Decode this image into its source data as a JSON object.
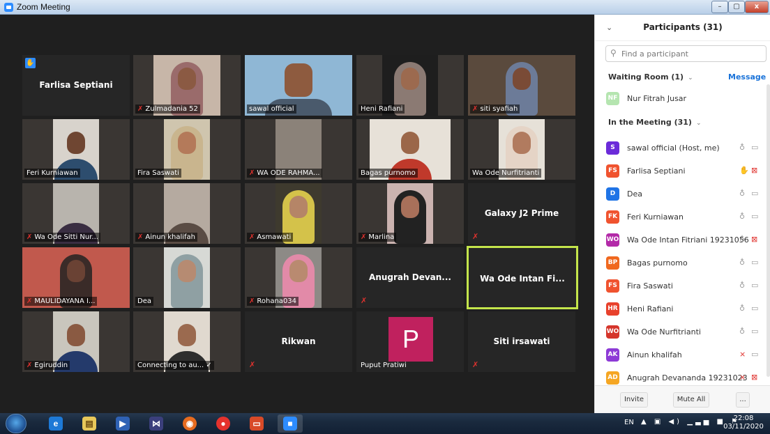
{
  "window": {
    "title": "Zoom Meeting",
    "min": "–",
    "max": "▢",
    "close": "x"
  },
  "tiles": [
    {
      "label": "Farlisa Septiani",
      "hand": true
    },
    {
      "label": "Zulmadania 52",
      "muted": true
    },
    {
      "label": "sawal official"
    },
    {
      "label": "Heni Rafiani"
    },
    {
      "label": "siti syafiah",
      "muted": true
    },
    {
      "label": "Feri Kurniawan"
    },
    {
      "label": "Fira Saswati"
    },
    {
      "label": "WA ODE RAHMA...",
      "muted": true
    },
    {
      "label": "Bagas purnomo"
    },
    {
      "label": "Wa Ode Nurfitrianti"
    },
    {
      "label": "Wa Ode Sitti Nur...",
      "muted": true
    },
    {
      "label": "Ainun khalifah",
      "muted": true
    },
    {
      "label": "Asmawati",
      "muted": true
    },
    {
      "label": "Marlina",
      "muted": true
    },
    {
      "label": "Galaxy J2 Prime"
    },
    {
      "label": "MAULIDAYANA I...",
      "muted": true
    },
    {
      "label": "Dea"
    },
    {
      "label": "Rohana034",
      "muted": true
    },
    {
      "label": "Anugrah  Devan..."
    },
    {
      "label": "Wa  Ode  Intan  Fi..."
    },
    {
      "label": "Egiruddin",
      "muted": true
    },
    {
      "label": "Connecting to au... ✓"
    },
    {
      "label": "Rikwan"
    },
    {
      "label": "Puput Pratiwi",
      "avatar": "P"
    },
    {
      "label": "Siti irsawati"
    }
  ],
  "panel": {
    "title": "Participants (31)",
    "search_placeholder": "Find a participant",
    "waiting_room": "Waiting Room (1)",
    "message": "Message",
    "in_meeting": "In the Meeting (31)",
    "waiting": [
      {
        "initials": "NF",
        "name": "Nur Fitrah Jusar",
        "color": "#b5e5b0"
      }
    ],
    "participants": [
      {
        "initials": "S",
        "name": "sawal official (Host, me)",
        "color": "#6b2bd9",
        "mic": "on",
        "cam": "on"
      },
      {
        "initials": "FS",
        "name": "Farlisa Septiani",
        "color": "#f0532f",
        "mic": "hand",
        "cam": "off"
      },
      {
        "initials": "D",
        "name": "Dea",
        "color": "#1f74e6",
        "mic": "on",
        "cam": "on"
      },
      {
        "initials": "FK",
        "name": "Feri Kurniawan",
        "color": "#f0532f",
        "mic": "on",
        "cam": "on"
      },
      {
        "initials": "WO",
        "name": "Wa Ode Intan Fitriani  19231056",
        "color": "#b32aa8",
        "mic": "on",
        "cam": "off"
      },
      {
        "initials": "BP",
        "name": "Bagas purnomo",
        "color": "#f0681e",
        "mic": "on",
        "cam": "on"
      },
      {
        "initials": "FS",
        "name": "Fira Saswati",
        "color": "#f0532f",
        "mic": "on",
        "cam": "on"
      },
      {
        "initials": "HR",
        "name": "Heni Rafiani",
        "color": "#e8412c",
        "mic": "on",
        "cam": "on"
      },
      {
        "initials": "WO",
        "name": "Wa Ode Nurfitrianti",
        "color": "#d5352b",
        "mic": "on",
        "cam": "on"
      },
      {
        "initials": "AK",
        "name": "Ainun khalifah",
        "color": "#8d3ad6",
        "mic": "off",
        "cam": "on"
      },
      {
        "initials": "AD",
        "name": "Anugrah Devananda 19231023",
        "color": "#f5a623",
        "mic": "off",
        "cam": "off"
      }
    ],
    "invite": "Invite",
    "mute_all": "Mute All",
    "more": "..."
  },
  "taskbar": {
    "lang": "EN",
    "time": "22:08",
    "date": "03/11/2020"
  }
}
